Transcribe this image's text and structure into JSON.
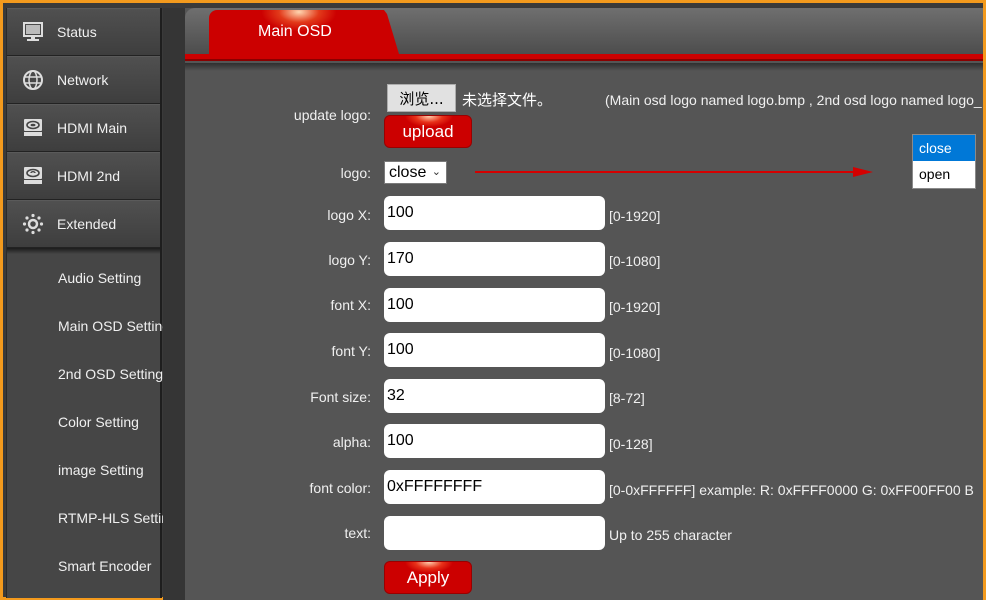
{
  "sidebar": {
    "nav": [
      {
        "label": "Status",
        "icon": "monitor-icon"
      },
      {
        "label": "Network",
        "icon": "globe-icon"
      },
      {
        "label": "HDMI Main",
        "icon": "hdmi-device-icon"
      },
      {
        "label": "HDMI 2nd",
        "icon": "hdmi-device-icon"
      },
      {
        "label": "Extended",
        "icon": "gear-icon"
      }
    ],
    "sub_items": [
      {
        "label": "Audio Setting"
      },
      {
        "label": "Main OSD Setting"
      },
      {
        "label": "2nd OSD Setting"
      },
      {
        "label": "Color Setting"
      },
      {
        "label": "image Setting"
      },
      {
        "label": "RTMP-HLS Setting"
      },
      {
        "label": "Smart Encoder"
      }
    ]
  },
  "tabs": [
    {
      "label": "Main OSD",
      "active": true
    }
  ],
  "form": {
    "update_logo": {
      "label": "update logo:",
      "browse_label": "浏览...",
      "no_file_text": "未选择文件。",
      "note": "(Main osd logo named logo.bmp , 2nd osd logo named logo_",
      "upload_label": "upload"
    },
    "logo": {
      "label": "logo:",
      "value": "close",
      "options": [
        "close",
        "open"
      ],
      "highlighted_option": "close"
    },
    "fields": [
      {
        "key": "logo_x",
        "label": "logo X:",
        "value": "100",
        "hint": "[0-1920]"
      },
      {
        "key": "logo_y",
        "label": "logo Y:",
        "value": "170",
        "hint": "[0-1080]"
      },
      {
        "key": "font_x",
        "label": "font X:",
        "value": "100",
        "hint": "[0-1920]"
      },
      {
        "key": "font_y",
        "label": "font Y:",
        "value": "100",
        "hint": "[0-1080]"
      },
      {
        "key": "font_size",
        "label": "Font size:",
        "value": "32",
        "hint": "[8-72]"
      },
      {
        "key": "alpha",
        "label": "alpha:",
        "value": "100",
        "hint": "[0-128]"
      },
      {
        "key": "font_color",
        "label": "font color:",
        "value": "0xFFFFFFFF",
        "hint": "[0-0xFFFFFF] example:  R: 0xFFFF0000 G: 0xFF00FF00 B"
      },
      {
        "key": "text",
        "label": "text:",
        "value": "",
        "hint": "Up to 255 character"
      }
    ],
    "apply_label": "Apply"
  },
  "colors": {
    "accent": "#cc0000",
    "frame": "#f39a1d",
    "dropdown_highlight": "#0078d7"
  }
}
